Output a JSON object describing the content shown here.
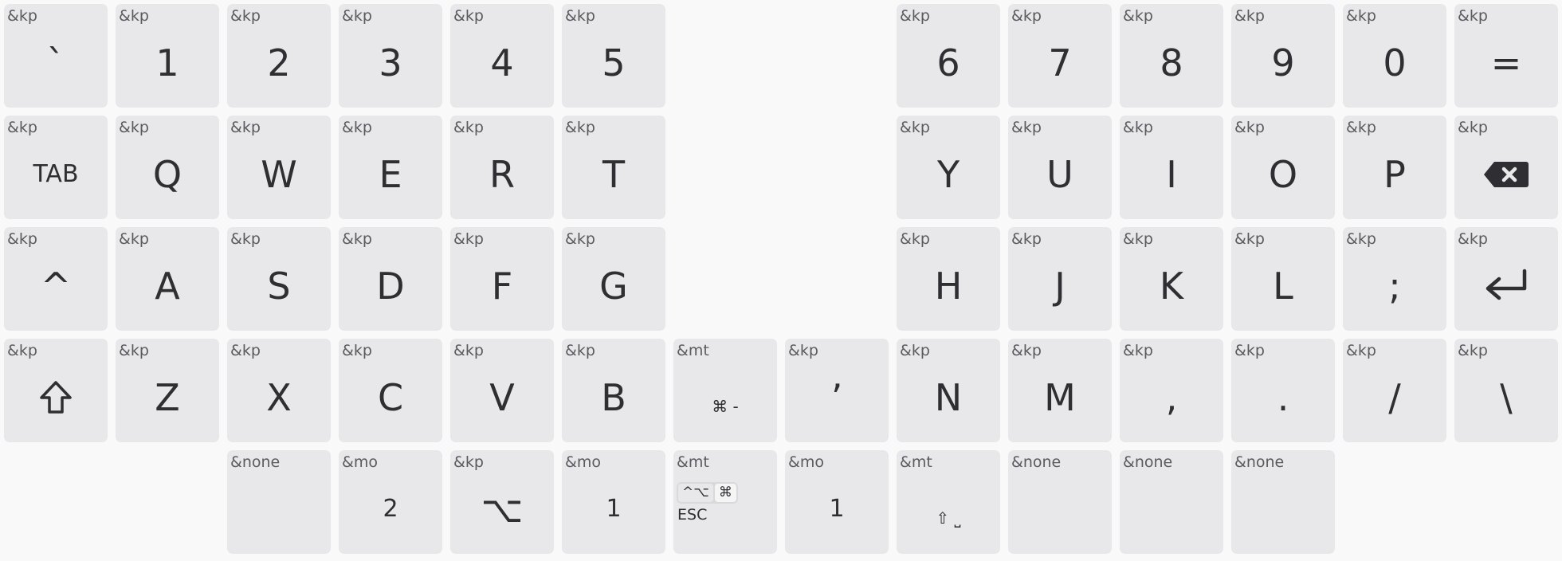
{
  "keys": [
    {
      "id": "grave",
      "behavior": "&kp",
      "label": "`",
      "col": 0,
      "row": 0
    },
    {
      "id": "n1",
      "behavior": "&kp",
      "label": "1",
      "col": 1,
      "row": 0
    },
    {
      "id": "n2",
      "behavior": "&kp",
      "label": "2",
      "col": 2,
      "row": 0
    },
    {
      "id": "n3",
      "behavior": "&kp",
      "label": "3",
      "col": 3,
      "row": 0
    },
    {
      "id": "n4",
      "behavior": "&kp",
      "label": "4",
      "col": 4,
      "row": 0
    },
    {
      "id": "n5",
      "behavior": "&kp",
      "label": "5",
      "col": 5,
      "row": 0
    },
    {
      "id": "n6",
      "behavior": "&kp",
      "label": "6",
      "col": 8,
      "row": 0
    },
    {
      "id": "n7",
      "behavior": "&kp",
      "label": "7",
      "col": 9,
      "row": 0
    },
    {
      "id": "n8",
      "behavior": "&kp",
      "label": "8",
      "col": 10,
      "row": 0
    },
    {
      "id": "n9",
      "behavior": "&kp",
      "label": "9",
      "col": 11,
      "row": 0
    },
    {
      "id": "n0",
      "behavior": "&kp",
      "label": "0",
      "col": 12,
      "row": 0
    },
    {
      "id": "equal",
      "behavior": "&kp",
      "label": "=",
      "col": 13,
      "row": 0
    },
    {
      "id": "tab",
      "behavior": "&kp",
      "label": "TAB",
      "col": 0,
      "row": 1,
      "size": "small"
    },
    {
      "id": "q",
      "behavior": "&kp",
      "label": "Q",
      "col": 1,
      "row": 1
    },
    {
      "id": "w",
      "behavior": "&kp",
      "label": "W",
      "col": 2,
      "row": 1
    },
    {
      "id": "e",
      "behavior": "&kp",
      "label": "E",
      "col": 3,
      "row": 1
    },
    {
      "id": "r",
      "behavior": "&kp",
      "label": "R",
      "col": 4,
      "row": 1
    },
    {
      "id": "t",
      "behavior": "&kp",
      "label": "T",
      "col": 5,
      "row": 1
    },
    {
      "id": "y",
      "behavior": "&kp",
      "label": "Y",
      "col": 8,
      "row": 1
    },
    {
      "id": "u",
      "behavior": "&kp",
      "label": "U",
      "col": 9,
      "row": 1
    },
    {
      "id": "i",
      "behavior": "&kp",
      "label": "I",
      "col": 10,
      "row": 1
    },
    {
      "id": "o",
      "behavior": "&kp",
      "label": "O",
      "col": 11,
      "row": 1
    },
    {
      "id": "p",
      "behavior": "&kp",
      "label": "P",
      "col": 12,
      "row": 1
    },
    {
      "id": "backspace",
      "behavior": "&kp",
      "label": "",
      "icon": "backspace-icon",
      "col": 13,
      "row": 1
    },
    {
      "id": "caret",
      "behavior": "&kp",
      "label": "^",
      "col": 0,
      "row": 2
    },
    {
      "id": "a",
      "behavior": "&kp",
      "label": "A",
      "col": 1,
      "row": 2
    },
    {
      "id": "s",
      "behavior": "&kp",
      "label": "S",
      "col": 2,
      "row": 2
    },
    {
      "id": "d",
      "behavior": "&kp",
      "label": "D",
      "col": 3,
      "row": 2
    },
    {
      "id": "f",
      "behavior": "&kp",
      "label": "F",
      "col": 4,
      "row": 2
    },
    {
      "id": "g",
      "behavior": "&kp",
      "label": "G",
      "col": 5,
      "row": 2
    },
    {
      "id": "h",
      "behavior": "&kp",
      "label": "H",
      "col": 8,
      "row": 2
    },
    {
      "id": "j",
      "behavior": "&kp",
      "label": "J",
      "col": 9,
      "row": 2
    },
    {
      "id": "k",
      "behavior": "&kp",
      "label": "K",
      "col": 10,
      "row": 2
    },
    {
      "id": "l",
      "behavior": "&kp",
      "label": "L",
      "col": 11,
      "row": 2
    },
    {
      "id": "semicolon",
      "behavior": "&kp",
      "label": ";",
      "col": 12,
      "row": 2
    },
    {
      "id": "enter",
      "behavior": "&kp",
      "label": "",
      "icon": "enter-icon",
      "col": 13,
      "row": 2
    },
    {
      "id": "shift",
      "behavior": "&kp",
      "label": "",
      "icon": "shift-icon",
      "col": 0,
      "row": 3
    },
    {
      "id": "z",
      "behavior": "&kp",
      "label": "Z",
      "col": 1,
      "row": 3
    },
    {
      "id": "x",
      "behavior": "&kp",
      "label": "X",
      "col": 2,
      "row": 3
    },
    {
      "id": "c",
      "behavior": "&kp",
      "label": "C",
      "col": 3,
      "row": 3
    },
    {
      "id": "v",
      "behavior": "&kp",
      "label": "V",
      "col": 4,
      "row": 3
    },
    {
      "id": "b",
      "behavior": "&kp",
      "label": "B",
      "col": 5,
      "row": 3
    },
    {
      "id": "cmd-minus",
      "behavior": "&mt",
      "label": "⌘ -",
      "col": 6,
      "row": 3,
      "size": "tiny"
    },
    {
      "id": "apostrophe",
      "behavior": "&kp",
      "label": "’",
      "col": 7,
      "row": 3
    },
    {
      "id": "nkey",
      "behavior": "&kp",
      "label": "N",
      "col": 8,
      "row": 3
    },
    {
      "id": "m",
      "behavior": "&kp",
      "label": "M",
      "col": 9,
      "row": 3
    },
    {
      "id": "comma",
      "behavior": "&kp",
      "label": ",",
      "col": 10,
      "row": 3
    },
    {
      "id": "period",
      "behavior": "&kp",
      "label": ".",
      "col": 11,
      "row": 3
    },
    {
      "id": "slash",
      "behavior": "&kp",
      "label": "/",
      "col": 12,
      "row": 3
    },
    {
      "id": "backslash",
      "behavior": "&kp",
      "label": "\\",
      "col": 13,
      "row": 3
    },
    {
      "id": "none1",
      "behavior": "&none",
      "label": "",
      "col": 2,
      "row": 4
    },
    {
      "id": "mo2",
      "behavior": "&mo",
      "label": "2",
      "col": 3,
      "row": 4,
      "size": "small"
    },
    {
      "id": "option",
      "behavior": "&kp",
      "label": "⌥",
      "col": 4,
      "row": 4
    },
    {
      "id": "mo1a",
      "behavior": "&mo",
      "label": "1",
      "col": 5,
      "row": 4,
      "size": "small"
    },
    {
      "id": "esc-mt",
      "behavior": "&mt",
      "label": "",
      "special": "esc",
      "col": 6,
      "row": 4
    },
    {
      "id": "mo1b",
      "behavior": "&mo",
      "label": "1",
      "col": 7,
      "row": 4,
      "size": "small"
    },
    {
      "id": "shift-space",
      "behavior": "&mt",
      "label": "⇧ ⎵",
      "col": 8,
      "row": 4,
      "size": "tiny"
    },
    {
      "id": "none2",
      "behavior": "&none",
      "label": "",
      "col": 9,
      "row": 4
    },
    {
      "id": "none3",
      "behavior": "&none",
      "label": "",
      "col": 10,
      "row": 4
    },
    {
      "id": "none4",
      "behavior": "&none",
      "label": "",
      "col": 11,
      "row": 4
    }
  ],
  "esc_key": {
    "hold_chip_1": "^⌥",
    "hold_chip_2": "⌘",
    "tap": "ESC"
  },
  "colors": {
    "background": "#f9f9f9",
    "key": "#e8e8ea",
    "text": "#2e2e33",
    "behavior_text": "#5a5a60"
  }
}
